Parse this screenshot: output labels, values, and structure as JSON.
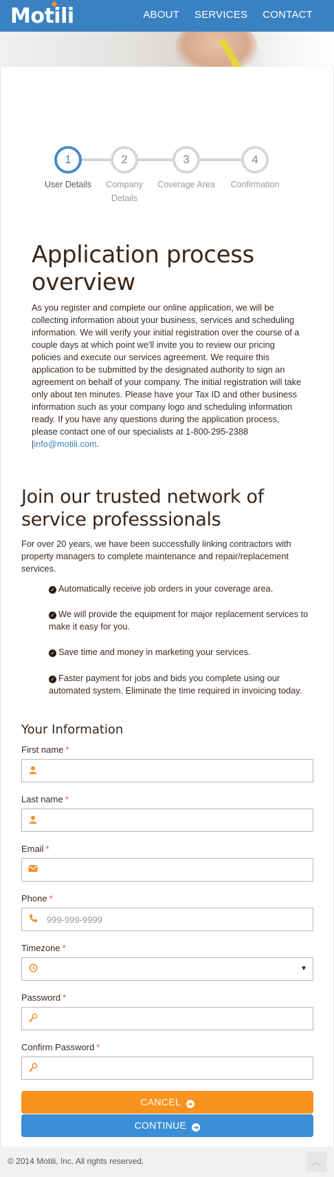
{
  "header": {
    "logo": "Motili",
    "nav": [
      "ABOUT",
      "SERVICES",
      "CONTACT"
    ]
  },
  "colors": {
    "brand_blue": "#3a81c2",
    "accent_orange": "#f7931e",
    "continue_blue": "#3a8fd8",
    "step_active": "#4a8bc7"
  },
  "stepper": {
    "current_step": 1,
    "steps": [
      {
        "number": "1",
        "label_line1": "User Details",
        "label_line2": ""
      },
      {
        "number": "2",
        "label_line1": "Company",
        "label_line2": "Details"
      },
      {
        "number": "3",
        "label_line1": "Coverage Area",
        "label_line2": ""
      },
      {
        "number": "4",
        "label_line1": "Confirmation",
        "label_line2": ""
      }
    ]
  },
  "overview": {
    "title": "Application process overview",
    "text": "As you register and complete our online application, we will be collecting information about your business, services and scheduling information. We will verify your initial registration over the course of a couple days at which point we'll invite you to review our pricing policies and execute our services agreement. We require this application to be submitted by the designated authority to sign an agreement on behalf of your company. The initial registration will take only about ten minutes. Please have your Tax ID and other business information such as your company logo and scheduling information ready. If you have any questions during the application process, please contact one of our specialists at 1-800-295-2388 |",
    "email": "info@motili.com",
    "text_end": "."
  },
  "join": {
    "title": "Join our trusted network of service professsionals",
    "text": "For over 20 years, we have been successfully linking contractors with property managers to complete maintenance and repair/replacement services.",
    "benefits": [
      "Automatically receive job orders in your coverage area.",
      "We will provide the equipment for major replacement services to make it easy for you.",
      "Save time and money in marketing your services.",
      "Faster payment for jobs and bids you complete using our automated system. Eliminate the time required in invoicing today."
    ]
  },
  "form": {
    "title": "Your Information",
    "required_mark": "*",
    "fields": {
      "first_name": {
        "label": "First name",
        "icon": "user-icon",
        "value": "",
        "placeholder": ""
      },
      "last_name": {
        "label": "Last name",
        "icon": "user-icon",
        "value": "",
        "placeholder": ""
      },
      "email": {
        "label": "Email",
        "icon": "envelope-icon",
        "value": "",
        "placeholder": ""
      },
      "phone": {
        "label": "Phone",
        "icon": "phone-icon",
        "value": "",
        "placeholder": "999-999-9999"
      },
      "timezone": {
        "label": "Timezone",
        "icon": "clock-icon",
        "value": ""
      },
      "password": {
        "label": "Password",
        "icon": "key-icon",
        "value": "",
        "placeholder": ""
      },
      "confirm_password": {
        "label": "Confirm Password",
        "icon": "key-icon",
        "value": "",
        "placeholder": ""
      }
    },
    "cancel_label": "CANCEL",
    "continue_label": "CONTINUE"
  },
  "footer": {
    "copyright": "© 2014 Motili, Inc. All rights reserved."
  }
}
